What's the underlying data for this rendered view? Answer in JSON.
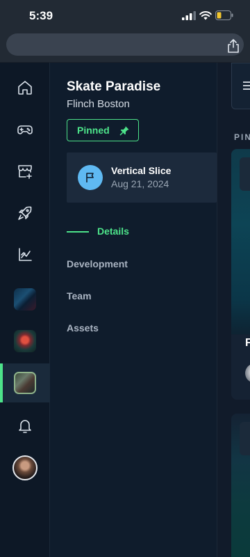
{
  "status_bar": {
    "time": "5:39",
    "icons": [
      "cellular-signal-icon",
      "wifi-icon",
      "battery-low-icon"
    ],
    "battery_color": "#f3c730"
  },
  "browser": {
    "url_text": "",
    "share_icon": "share-icon"
  },
  "rail": {
    "items": [
      {
        "name": "home",
        "icon": "home-icon"
      },
      {
        "name": "games",
        "icon": "gamepad-icon"
      },
      {
        "name": "store",
        "icon": "store-add-icon"
      },
      {
        "name": "launch",
        "icon": "rocket-icon"
      },
      {
        "name": "analytics",
        "icon": "chart-icon"
      },
      {
        "name": "project-1",
        "icon": "project-thumbnail"
      },
      {
        "name": "project-2",
        "icon": "project-thumbnail"
      },
      {
        "name": "project-3",
        "icon": "project-thumbnail",
        "active": true
      },
      {
        "name": "notifications",
        "icon": "bell-icon"
      },
      {
        "name": "profile",
        "icon": "avatar"
      }
    ],
    "active_color": "#4de38a"
  },
  "project": {
    "title": "Skate Paradise",
    "studio": "Flinch Boston",
    "pinned_label": "Pinned",
    "pin_icon": "pin-icon",
    "milestone": {
      "icon": "flag-icon",
      "title": "Vertical Slice",
      "date": "Aug 21, 2024"
    },
    "nav": {
      "active": "Details",
      "items": [
        "Development",
        "Team",
        "Assets"
      ]
    },
    "accent": "#4de38a"
  },
  "right_panel": {
    "menu_icon": "menu-icon",
    "section_label": "PIN",
    "card_initial": "F"
  }
}
